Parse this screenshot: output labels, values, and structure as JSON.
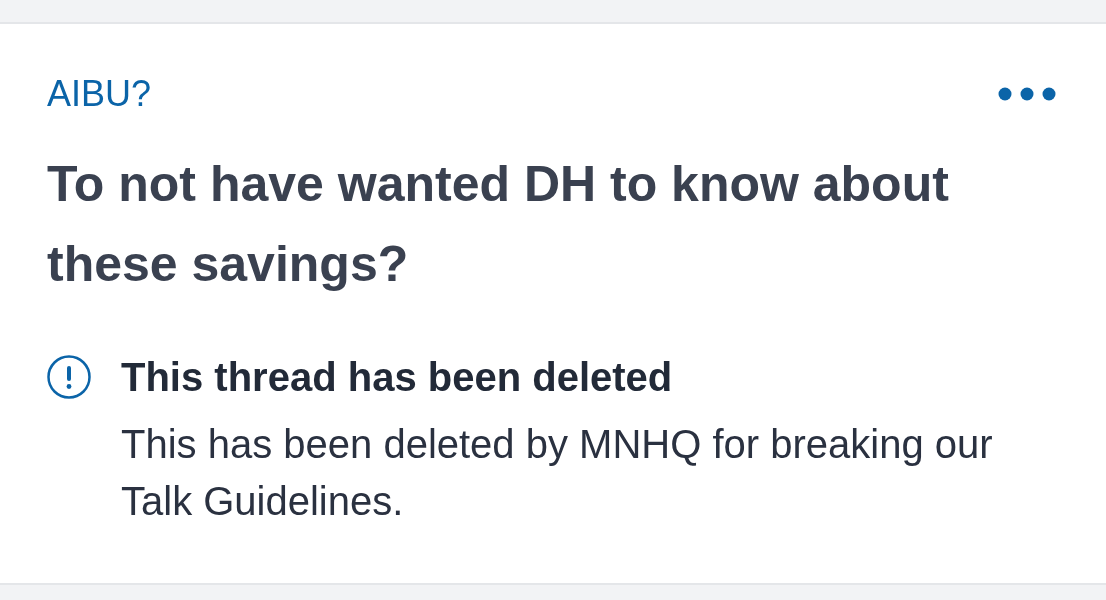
{
  "post": {
    "category": "AIBU?",
    "title": "To not have wanted DH to know about these savings?",
    "notice": {
      "heading": "This thread has been deleted",
      "body": "This has been deleted by MNHQ for breaking our Talk Guidelines."
    }
  }
}
